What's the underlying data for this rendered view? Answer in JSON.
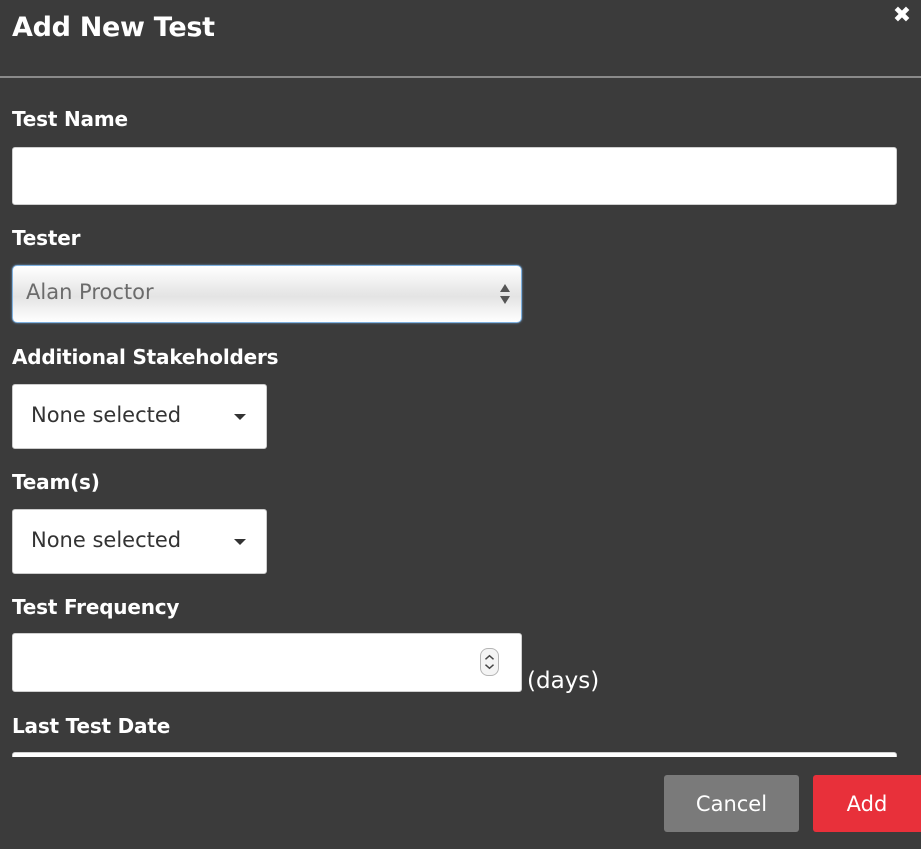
{
  "modal": {
    "title": "Add New Test",
    "close_glyph": "✖"
  },
  "form": {
    "test_name": {
      "label": "Test Name",
      "value": "",
      "placeholder": ""
    },
    "tester": {
      "label": "Tester",
      "selected": "Alan Proctor"
    },
    "stakeholders": {
      "label": "Additional Stakeholders",
      "selected": "None selected"
    },
    "teams": {
      "label": "Team(s)",
      "selected": "None selected"
    },
    "frequency": {
      "label": "Test Frequency",
      "value": "",
      "suffix": "(days)"
    },
    "last_test_date": {
      "label": "Last Test Date",
      "value": ""
    }
  },
  "footer": {
    "cancel_label": "Cancel",
    "add_label": "Add"
  },
  "icons": {
    "close": "close-icon",
    "select_arrows": "sort-arrows-icon",
    "caret": "caret-down-icon",
    "spinner": "number-spinner-icon"
  },
  "colors": {
    "background": "#3b3b3b",
    "add_button": "#e8303a",
    "cancel_button": "#7a7a7a",
    "header_divider": "#8a8a8a"
  }
}
